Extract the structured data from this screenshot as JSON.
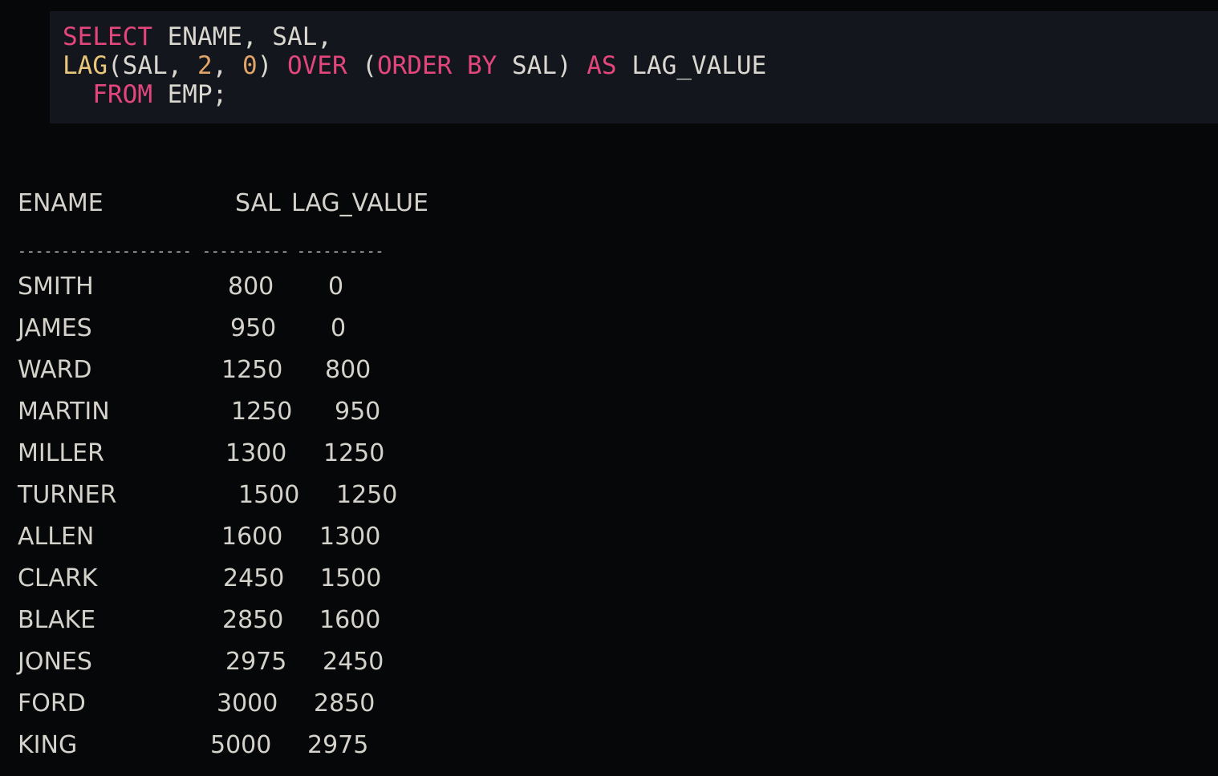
{
  "query": {
    "line1": {
      "kw_select": "SELECT",
      "rest": " ENAME, SAL,"
    },
    "line2": {
      "fn_lag": "LAG",
      "open": "(SAL, ",
      "offset": "2",
      "comma": ", ",
      "default": "0",
      "close": ") ",
      "kw_over": "OVER",
      "paren": " (",
      "kw_orderby": "ORDER BY",
      "sal": " SAL) ",
      "kw_as": "AS",
      "alias": " LAG_VALUE"
    },
    "line3": {
      "indent": "  ",
      "kw_from": "FROM",
      "table": " EMP;"
    }
  },
  "result": {
    "headers": [
      "ENAME",
      "SAL",
      "LAG_VALUE"
    ],
    "separators": [
      "--------------------",
      "----------",
      "----------"
    ],
    "rows": [
      {
        "ename": "SMITH",
        "sal": "800",
        "lag": "0"
      },
      {
        "ename": "JAMES",
        "sal": "950",
        "lag": "0"
      },
      {
        "ename": "WARD",
        "sal": "1250",
        "lag": "800"
      },
      {
        "ename": "MARTIN",
        "sal": "1250",
        "lag": "950"
      },
      {
        "ename": "MILLER",
        "sal": "1300",
        "lag": "1250"
      },
      {
        "ename": "TURNER",
        "sal": "1500",
        "lag": "1250"
      },
      {
        "ename": "ALLEN",
        "sal": "1600",
        "lag": "1300"
      },
      {
        "ename": "CLARK",
        "sal": "2450",
        "lag": "1500"
      },
      {
        "ename": "BLAKE",
        "sal": "2850",
        "lag": "1600"
      },
      {
        "ename": "JONES",
        "sal": "2975",
        "lag": "2450"
      },
      {
        "ename": "FORD",
        "sal": "3000",
        "lag": "2850"
      },
      {
        "ename": "KING",
        "sal": "5000",
        "lag": "2975"
      }
    ]
  },
  "colors": {
    "background": "#050709",
    "code_background": "#14161d",
    "keyword": "#e2467b",
    "function": "#eac67a",
    "number": "#e0a468",
    "text": "#d4d2cb"
  }
}
